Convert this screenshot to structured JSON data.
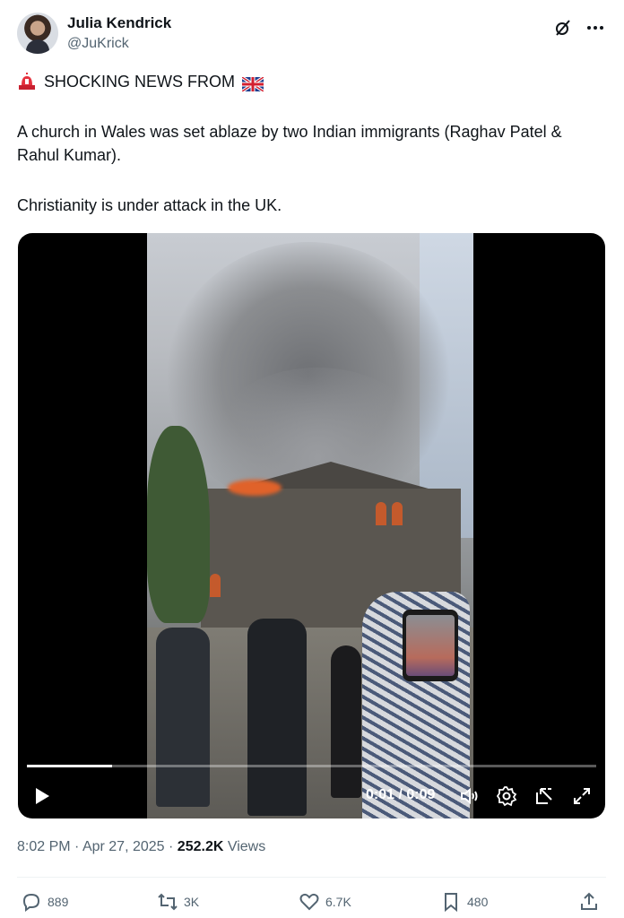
{
  "author": {
    "name": "Julia Kendrick",
    "handle": "@JuKrick"
  },
  "header_icons": [
    "grok-icon",
    "more-icon"
  ],
  "tweet": {
    "headline": "SHOCKING NEWS FROM",
    "headline_icons": [
      "siren-emoji",
      "uk-flag-emoji"
    ],
    "paragraph1": "A church in Wales was set ablaze by two Indian immigrants (Raghav Patel & Rahul Kumar).",
    "paragraph2": "Christianity is under attack in the UK."
  },
  "video": {
    "current_time": "0:01 / 0:09",
    "progress_fraction": 0.15,
    "controls": [
      "play-icon",
      "volume-icon",
      "settings-icon",
      "pop-out-icon",
      "fullscreen-icon"
    ]
  },
  "meta": {
    "time": "8:02 PM",
    "separator": "·",
    "date": "Apr 27, 2025",
    "views_count": "252.2K",
    "views_label": "Views"
  },
  "actions": {
    "replies": "889",
    "reposts": "3K",
    "likes": "6.7K",
    "bookmarks": "480"
  },
  "colors": {
    "text": "#0f1419",
    "secondary": "#536471",
    "divider": "#eff3f4",
    "video_bg": "#000000"
  }
}
